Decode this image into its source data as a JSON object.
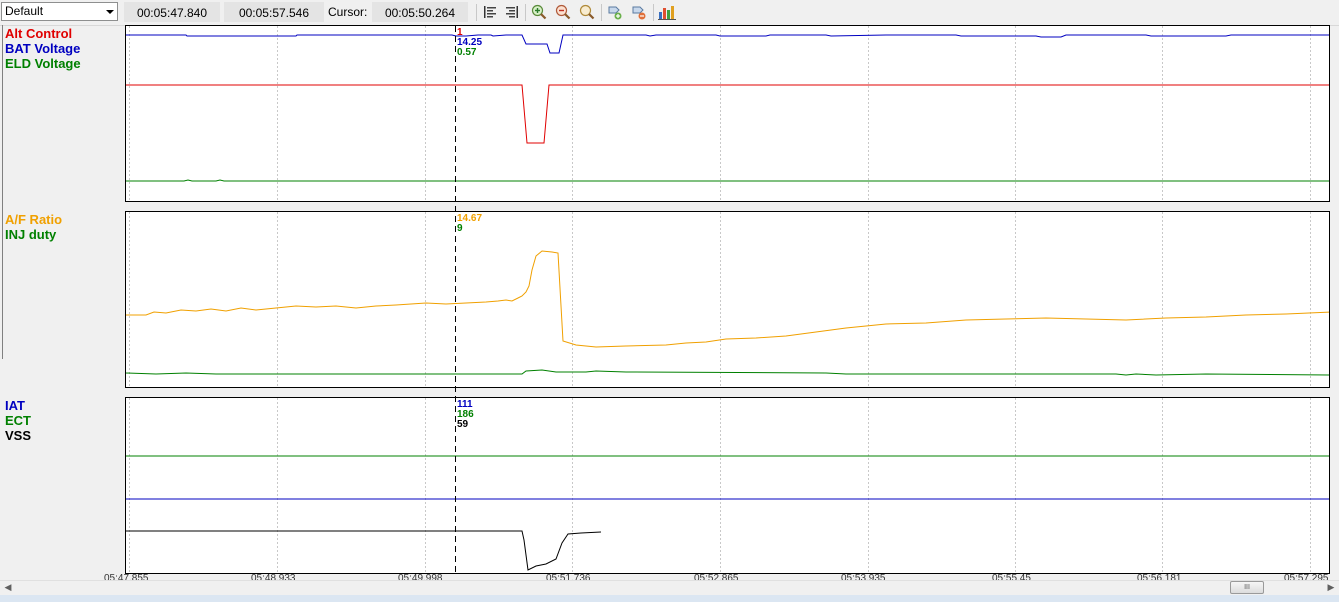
{
  "toolbar": {
    "profile": "Default",
    "start_time": "00:05:47.840",
    "end_time": "00:05:57.546",
    "cursor_label": "Cursor:",
    "cursor_time": "00:05:50.264"
  },
  "icons": [
    "align-left-icon",
    "align-right-icon",
    "zoom-in-icon",
    "zoom-out-icon",
    "zoom-fit-icon",
    "add-marker-icon",
    "remove-marker-icon",
    "chart-settings-icon"
  ],
  "panels": [
    {
      "labels": [
        {
          "text": "Alt Control",
          "color": "#e00000"
        },
        {
          "text": "BAT Voltage",
          "color": "#0000c0"
        },
        {
          "text": "ELD Voltage",
          "color": "#008000"
        }
      ],
      "cursor_values": [
        {
          "text": "1",
          "color": "#e00000"
        },
        {
          "text": "14.25",
          "color": "#0000c0"
        },
        {
          "text": "0.57",
          "color": "#008000"
        }
      ]
    },
    {
      "labels": [
        {
          "text": "A/F Ratio",
          "color": "#f0a000"
        },
        {
          "text": "INJ duty",
          "color": "#008000"
        }
      ],
      "cursor_values": [
        {
          "text": "14.67",
          "color": "#f0a000"
        },
        {
          "text": "9",
          "color": "#008000"
        }
      ]
    },
    {
      "labels": [
        {
          "text": "IAT",
          "color": "#0000c0"
        },
        {
          "text": "ECT",
          "color": "#008000"
        },
        {
          "text": "VSS",
          "color": "#000000"
        }
      ],
      "cursor_values": [
        {
          "text": "111",
          "color": "#0000c0"
        },
        {
          "text": "186",
          "color": "#008000"
        },
        {
          "text": "59",
          "color": "#000000"
        }
      ]
    }
  ],
  "axis_ticks": [
    "05:47.855",
    "05:48.933",
    "05:49.998",
    "05:51.736",
    "05:52.865",
    "05:53.935",
    "05:55.45",
    "05:56.181",
    "05:57.295"
  ],
  "scrollbar": {
    "left_arrow": "◀",
    "right_arrow": "▶",
    "thumb_grip": "III"
  },
  "chart_data": {
    "type": "line",
    "x_range": [
      "00:05:47.840",
      "00:05:57.546"
    ],
    "cursor_x": "00:05:50.264",
    "grid": true,
    "series": [
      {
        "name": "Alt Control",
        "color": "#e00000",
        "cursor_value": 1,
        "shape": [
          [
            0,
            1
          ],
          [
            0.332,
            1
          ],
          [
            0.334,
            0
          ],
          [
            0.349,
            0
          ],
          [
            0.351,
            1
          ],
          [
            1,
            1
          ]
        ]
      },
      {
        "name": "BAT Voltage",
        "color": "#0000c0",
        "cursor_value": 14.25,
        "shape": [
          [
            0,
            14.25
          ],
          [
            0.328,
            14.25
          ],
          [
            0.333,
            14.0
          ],
          [
            0.348,
            13.9
          ],
          [
            0.352,
            13.5
          ],
          [
            0.359,
            13.5
          ],
          [
            0.363,
            14.25
          ],
          [
            1,
            14.25
          ]
        ]
      },
      {
        "name": "ELD Voltage",
        "color": "#008000",
        "cursor_value": 0.57,
        "shape": [
          [
            0,
            0.57
          ],
          [
            1,
            0.57
          ]
        ]
      },
      {
        "name": "A/F Ratio",
        "color": "#f0a000",
        "cursor_value": 14.67,
        "shape": [
          [
            0,
            14.5
          ],
          [
            0.3,
            14.67
          ],
          [
            0.34,
            15.3
          ],
          [
            0.355,
            17.5
          ],
          [
            0.37,
            17.6
          ],
          [
            0.38,
            13.5
          ],
          [
            0.45,
            13.4
          ],
          [
            0.6,
            13.9
          ],
          [
            0.8,
            14.3
          ],
          [
            1,
            14.5
          ]
        ]
      },
      {
        "name": "INJ duty",
        "color": "#008000",
        "cursor_value": 9,
        "shape": [
          [
            0,
            9
          ],
          [
            0.33,
            9
          ],
          [
            0.34,
            9.3
          ],
          [
            0.36,
            9.2
          ],
          [
            0.5,
            9
          ],
          [
            1,
            8.9
          ]
        ]
      },
      {
        "name": "IAT",
        "color": "#0000c0",
        "cursor_value": 111,
        "shape": [
          [
            0,
            111
          ],
          [
            1,
            111
          ]
        ]
      },
      {
        "name": "ECT",
        "color": "#008000",
        "cursor_value": 186,
        "shape": [
          [
            0,
            186
          ],
          [
            1,
            186
          ]
        ]
      },
      {
        "name": "VSS",
        "color": "#000000",
        "cursor_value": 59,
        "shape": [
          [
            0,
            59
          ],
          [
            0.332,
            59
          ],
          [
            0.335,
            0
          ],
          [
            0.35,
            3
          ],
          [
            0.36,
            8
          ],
          [
            0.365,
            58
          ],
          [
            0.39,
            59
          ]
        ]
      }
    ]
  }
}
